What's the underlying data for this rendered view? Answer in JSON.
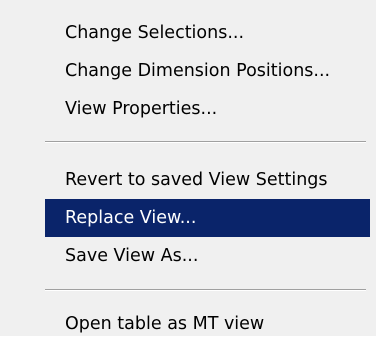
{
  "context_menu": {
    "groups": [
      {
        "items": [
          {
            "label": "Change Selections..."
          },
          {
            "label": "Change Dimension Positions..."
          },
          {
            "label": "View Properties..."
          }
        ]
      },
      {
        "items": [
          {
            "label": "Revert to saved View Settings"
          },
          {
            "label": "Replace View...",
            "highlighted": true
          },
          {
            "label": "Save View As..."
          }
        ]
      },
      {
        "items": [
          {
            "label": "Open table as MT view"
          }
        ]
      }
    ]
  },
  "colors": {
    "menu_background": "#f0f0f0",
    "highlight_background": "#0a246a",
    "highlight_text": "#ffffff",
    "separator_shadow": "#a0a0a0"
  }
}
